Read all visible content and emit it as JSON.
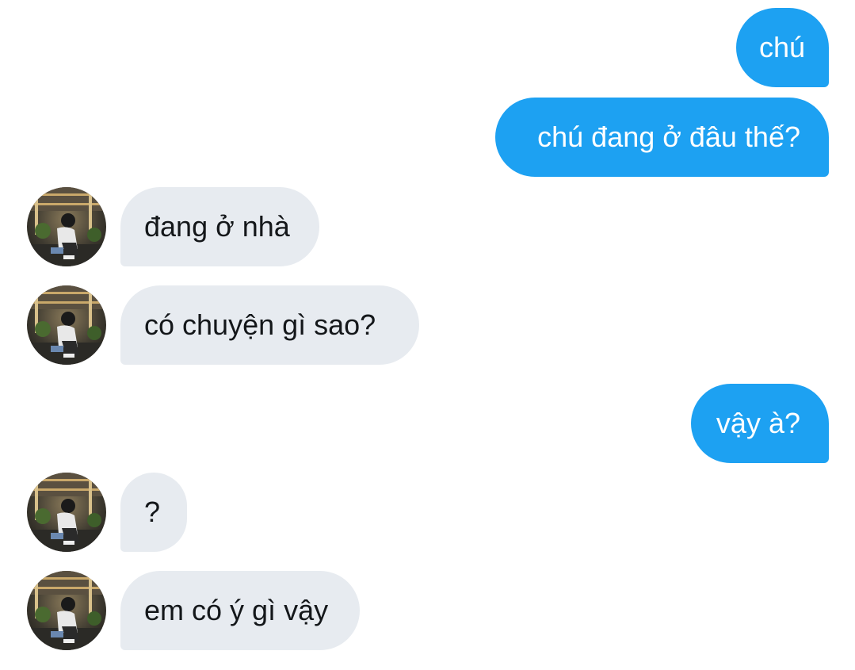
{
  "conversation": {
    "messages": [
      {
        "direction": "outgoing",
        "text": "chú"
      },
      {
        "direction": "outgoing",
        "text": "chú đang ở đâu thế?"
      },
      {
        "direction": "incoming",
        "text": "đang ở nhà"
      },
      {
        "direction": "incoming",
        "text": "có chuyện gì sao?"
      },
      {
        "direction": "outgoing",
        "text": "vậy à?"
      },
      {
        "direction": "incoming",
        "text": "?"
      },
      {
        "direction": "incoming",
        "text": "em có ý gì vậy"
      }
    ]
  },
  "colors": {
    "outgoing_bubble": "#1da1f2",
    "incoming_bubble": "#e7ebf0",
    "outgoing_text": "#ffffff",
    "incoming_text": "#14171a"
  },
  "icons": {
    "avatar": "contact-avatar-photo"
  }
}
